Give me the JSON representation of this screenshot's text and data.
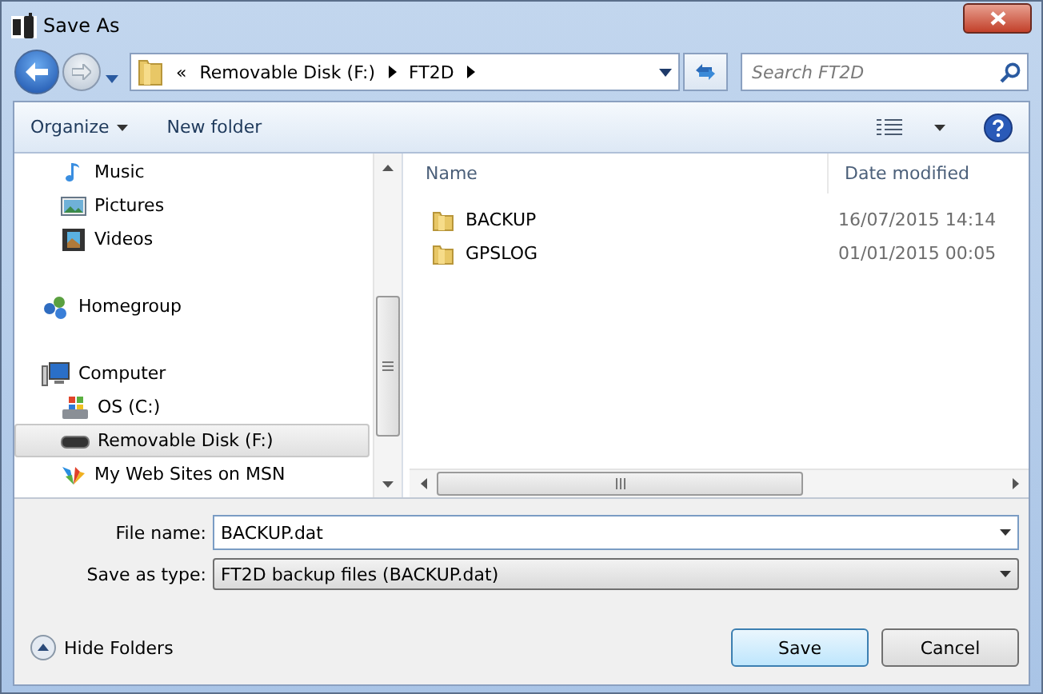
{
  "window": {
    "title": "Save As"
  },
  "address": {
    "overflow": "«",
    "segments": [
      "Removable Disk (F:)",
      "FT2D"
    ]
  },
  "search": {
    "placeholder": "Search FT2D"
  },
  "toolbar": {
    "organize": "Organize",
    "new_folder": "New folder"
  },
  "sidebar": {
    "sections": [
      {
        "kind": "libraries",
        "items": [
          {
            "label": "Music",
            "kind": "music",
            "selected": false
          },
          {
            "label": "Pictures",
            "kind": "pictures",
            "selected": false
          },
          {
            "label": "Videos",
            "kind": "videos",
            "selected": false
          }
        ]
      },
      {
        "kind": "root",
        "items": [
          {
            "label": "Homegroup",
            "kind": "homegroup",
            "selected": false
          }
        ]
      },
      {
        "kind": "root",
        "items": [
          {
            "label": "Computer",
            "kind": "computer",
            "selected": false,
            "children": [
              {
                "label": "OS (C:)",
                "kind": "drive",
                "selected": false
              },
              {
                "label": "Removable Disk (F:)",
                "kind": "removable",
                "selected": true
              },
              {
                "label": "My Web Sites on MSN",
                "kind": "web",
                "selected": false
              }
            ]
          }
        ]
      }
    ]
  },
  "files": {
    "columns": [
      "Name",
      "Date modified"
    ],
    "rows": [
      {
        "name": "BACKUP",
        "date": "16/07/2015 14:14"
      },
      {
        "name": "GPSLOG",
        "date": "01/01/2015 00:05"
      }
    ]
  },
  "file_name": {
    "label": "File name:",
    "value": "BACKUP.dat"
  },
  "save_type": {
    "label": "Save as type:",
    "value": "FT2D backup files (BACKUP.dat)"
  },
  "hide_folders": "Hide Folders",
  "buttons": {
    "save": "Save",
    "cancel": "Cancel"
  }
}
